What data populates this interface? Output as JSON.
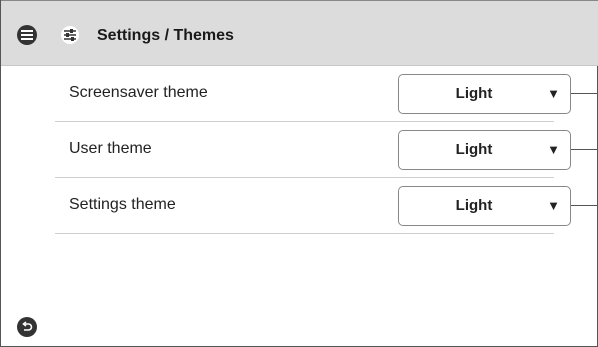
{
  "header": {
    "title": "Settings / Themes",
    "menu_icon": "menu-icon",
    "settings_icon": "sliders-icon"
  },
  "settings": [
    {
      "label": "Screensaver theme",
      "value": "Light",
      "arrow": "▼"
    },
    {
      "label": "User theme",
      "value": "Light",
      "arrow": "▼"
    },
    {
      "label": "Settings theme",
      "value": "Light",
      "arrow": "▼"
    }
  ],
  "footer": {
    "back_icon": "back-icon"
  },
  "colors": {
    "header_bg": "#dcdcdc",
    "text": "#222222",
    "icon_dark": "#333333"
  }
}
